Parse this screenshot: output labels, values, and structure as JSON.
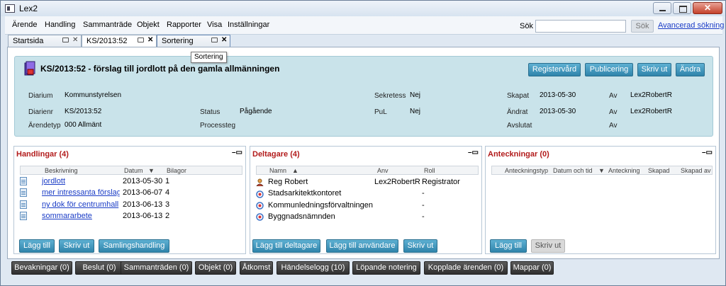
{
  "window": {
    "title": "Lex2"
  },
  "menu": [
    "Ärende",
    "Handling",
    "Sammanträde",
    "Objekt",
    "Rapporter",
    "Visa",
    "Inställningar"
  ],
  "search": {
    "label": "Sök",
    "value": "",
    "button": "Sök",
    "advanced": "Avancerad sökning"
  },
  "tabs": [
    {
      "label": "Startsida"
    },
    {
      "label": "KS/2013:52"
    },
    {
      "label": "Sortering"
    }
  ],
  "tooltip": "Sortering",
  "case": {
    "title": "KS/2013:52 - förslag till jordlott på den gamla allmänningen",
    "buttons": [
      "Registervård",
      "Publicering",
      "Skriv ut",
      "Ändra"
    ],
    "fields": {
      "diarium_label": "Diarium",
      "diarium": "Kommunstyrelsen",
      "diarienr_label": "Diarienr",
      "diarienr": "KS/2013:52",
      "arendetyp_label": "Ärendetyp",
      "arendetyp": "000 Allmänt",
      "status_label": "Status",
      "status": "Pågående",
      "processteg_label": "Processteg",
      "processteg": "",
      "sekretess_label": "Sekretess",
      "sekretess": "Nej",
      "pul_label": "PuL",
      "pul": "Nej",
      "skapat_label": "Skapat",
      "skapat": "2013-05-30",
      "andrat_label": "Ändrat",
      "andrat": "2013-05-30",
      "avslutat_label": "Avslutat",
      "avslutat": "",
      "av_label": "Av",
      "skapat_av": "Lex2RobertR",
      "andrat_av": "Lex2RobertR",
      "avslutat_av": ""
    }
  },
  "handlingar": {
    "title": "Handlingar (4)",
    "columns": [
      "Beskrivning",
      "Datum",
      "Bilagor"
    ],
    "rows": [
      {
        "beskrivning": "jordlott",
        "datum": "2013-05-30",
        "bilagor": "1"
      },
      {
        "beskrivning": "mer intressanta förslag",
        "datum": "2013-06-07",
        "bilagor": "4"
      },
      {
        "beskrivning": "ny dok för centrumhall",
        "datum": "2013-06-13",
        "bilagor": "3"
      },
      {
        "beskrivning": "sommararbete",
        "datum": "2013-06-13",
        "bilagor": "2"
      }
    ],
    "buttons": [
      "Lägg till",
      "Skriv ut",
      "Samlingshandling"
    ]
  },
  "deltagare": {
    "title": "Deltagare (4)",
    "columns": [
      "Namn",
      "Anv",
      "Roll"
    ],
    "rows": [
      {
        "namn": "Reg Robert",
        "anv": "Lex2RobertR",
        "roll": "Registrator"
      },
      {
        "namn": "Stadsarkitektkontoret",
        "anv": "",
        "roll": "-"
      },
      {
        "namn": "Kommunledningsförvaltningen",
        "anv": "",
        "roll": "-"
      },
      {
        "namn": "Byggnadsnämnden",
        "anv": "",
        "roll": "-"
      }
    ],
    "buttons": [
      "Lägg till deltagare",
      "Lägg till användare",
      "Skriv ut"
    ]
  },
  "anteckningar": {
    "title": "Anteckningar (0)",
    "columns": [
      "Anteckningstyp",
      "Datum och tid",
      "Anteckning",
      "Skapad",
      "Skapad av"
    ],
    "buttons": [
      "Lägg till",
      "Skriv ut"
    ]
  },
  "bottom_tabs": [
    "Bevakningar (0)",
    "Beslut (0)",
    "Sammanträden (0)",
    "Objekt (0)",
    "Åtkomst",
    "Händelselogg (10)",
    "Löpande notering",
    "Kopplade ärenden (0)",
    "Mappar (0)"
  ]
}
